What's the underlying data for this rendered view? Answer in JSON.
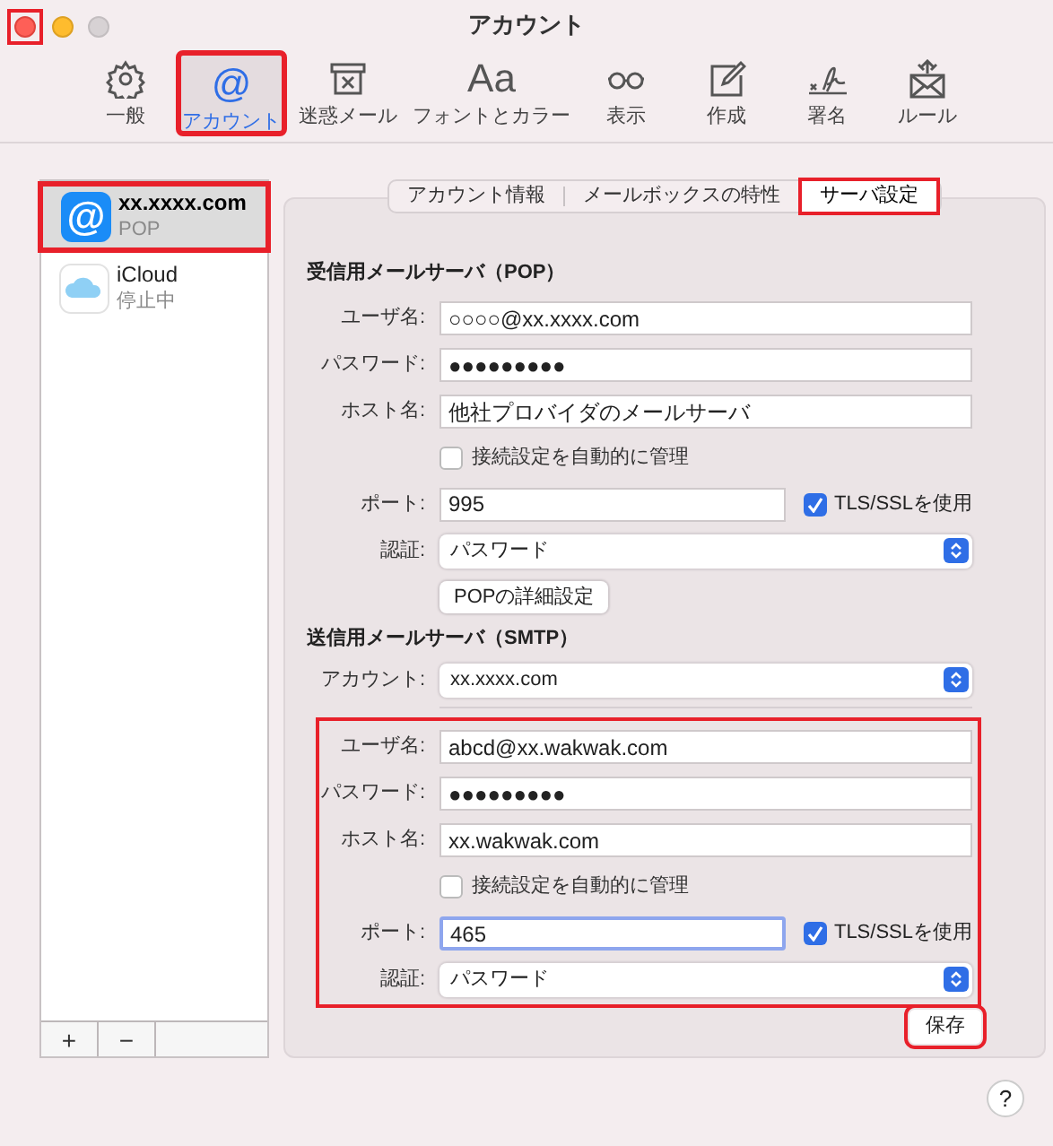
{
  "window": {
    "title": "アカウント",
    "close_highlighted": true
  },
  "toolbar": [
    {
      "kind": "gear",
      "label": "一般",
      "selected": false,
      "highlighted": false
    },
    {
      "kind": "glyph",
      "glyph": "@",
      "label": "アカウント",
      "selected": true,
      "highlighted": true
    },
    {
      "kind": "junk",
      "label": "迷惑メール",
      "selected": false,
      "highlighted": false
    },
    {
      "kind": "glyph",
      "glyph": "Aa",
      "label": "フォントとカラー",
      "selected": false,
      "highlighted": false
    },
    {
      "kind": "glasses",
      "label": "表示",
      "selected": false,
      "highlighted": false
    },
    {
      "kind": "compose",
      "label": "作成",
      "selected": false,
      "highlighted": false
    },
    {
      "kind": "signature",
      "label": "署名",
      "selected": false,
      "highlighted": false
    },
    {
      "kind": "rules",
      "label": "ルール",
      "selected": false,
      "highlighted": false
    }
  ],
  "accounts": [
    {
      "kind": "at",
      "glyph": "@",
      "name": "xx.xxxx.com",
      "status": "POP",
      "selected": true,
      "highlighted": true
    },
    {
      "kind": "cloud",
      "name": "iCloud",
      "status": "停止中",
      "selected": false,
      "highlighted": false
    }
  ],
  "list_buttons": [
    "+",
    "−"
  ],
  "tabs": [
    {
      "label": "アカウント情報",
      "selected": false,
      "highlighted": false
    },
    {
      "label": "メールボックスの特性",
      "selected": false,
      "highlighted": false
    },
    {
      "label": "サーバ設定",
      "selected": true,
      "highlighted": true
    }
  ],
  "incoming": {
    "heading": "受信用メールサーバ（POP）",
    "rows": [
      {
        "kind": "text",
        "label": "ユーザ名:",
        "value": "○○○○@xx.xxxx.com"
      },
      {
        "kind": "text",
        "label": "パスワード:",
        "value": "●●●●●●●●●"
      },
      {
        "kind": "text",
        "label": "ホスト名:",
        "value": "他社プロバイダのメールサーバ"
      },
      {
        "kind": "checkbox",
        "label": "接続設定を自動的に管理",
        "checked": false
      },
      {
        "kind": "port",
        "label": "ポート:",
        "value": "995",
        "focused": false,
        "option": "TLS/SSLを使用",
        "checked": true
      },
      {
        "kind": "popup",
        "label": "認証:",
        "value": "パスワード"
      },
      {
        "kind": "button",
        "label": "POPの詳細設定"
      }
    ]
  },
  "outgoing": {
    "heading": "送信用メールサーバ（SMTP）",
    "rows": [
      {
        "kind": "popup",
        "label": "アカウント:",
        "value": "xx.xxxx.com"
      }
    ],
    "details": {
      "highlighted": true,
      "rows": [
        {
          "kind": "text",
          "label": "ユーザ名:",
          "value": "abcd@xx.wakwak.com"
        },
        {
          "kind": "text",
          "label": "パスワード:",
          "value": "●●●●●●●●●"
        },
        {
          "kind": "text",
          "label": "ホスト名:",
          "value": "xx.wakwak.com"
        },
        {
          "kind": "checkbox",
          "label": "接続設定を自動的に管理",
          "checked": false
        },
        {
          "kind": "port",
          "label": "ポート:",
          "value": "465",
          "focused": true,
          "option": "TLS/SSLを使用",
          "checked": true
        },
        {
          "kind": "popup",
          "label": "認証:",
          "value": "パスワード"
        }
      ]
    }
  },
  "save": {
    "label": "保存",
    "highlighted": true
  },
  "help": "?"
}
